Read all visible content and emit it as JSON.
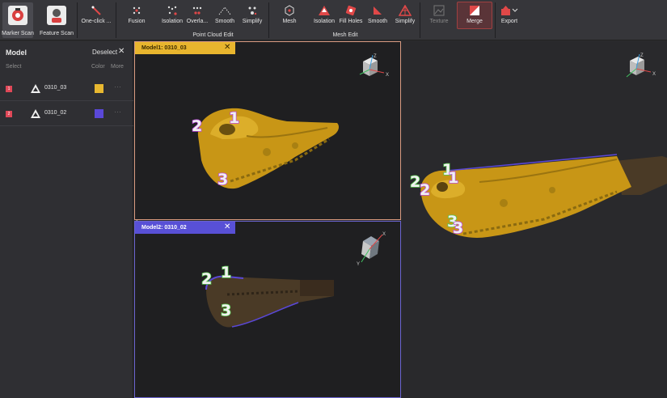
{
  "toolbar": {
    "marker_scan": "Marker Scan",
    "feature_scan": "Feature Scan",
    "one_click": "One-click ...",
    "fusion": "Fusion",
    "pc_isolation": "Isolation",
    "pc_overlap": "Overla...",
    "pc_smooth": "Smooth",
    "pc_simplify": "Simplify",
    "point_cloud_group": "Point Cloud Edit",
    "mesh": "Mesh",
    "mesh_isolation": "Isolation",
    "fill_holes": "Fill Holes",
    "mesh_smooth": "Smooth",
    "mesh_simplify": "Simplify",
    "mesh_group": "Mesh Edit",
    "texture": "Texture",
    "merge": "Merge",
    "export": "Export"
  },
  "panel": {
    "title": "Model",
    "deselect": "Deselect",
    "close": "✕",
    "col_select": "Select",
    "col_color": "Color",
    "col_more": "More",
    "models": [
      {
        "index": "1",
        "name": "0310_03",
        "color": "#e8b830",
        "more": "···"
      },
      {
        "index": "2",
        "name": "0310_02",
        "color": "#5a48d8",
        "more": "···"
      }
    ]
  },
  "viewports": {
    "model1": {
      "tab": "Model1: 0310_03",
      "close": "✕",
      "tab_color": "#e8b52e"
    },
    "model2": {
      "tab": "Model2: 0310_02",
      "close": "✕",
      "tab_color": "#5850d6"
    }
  },
  "axes": {
    "x": "X",
    "y": "Y",
    "z": "Z"
  },
  "markers": {
    "m1": [
      "1",
      "2",
      "3"
    ],
    "m2": [
      "1",
      "2",
      "3"
    ],
    "merged_green": [
      "1",
      "2",
      "3"
    ],
    "merged_purple": [
      "1",
      "2",
      "3"
    ]
  },
  "collapse_glyph": "‹"
}
